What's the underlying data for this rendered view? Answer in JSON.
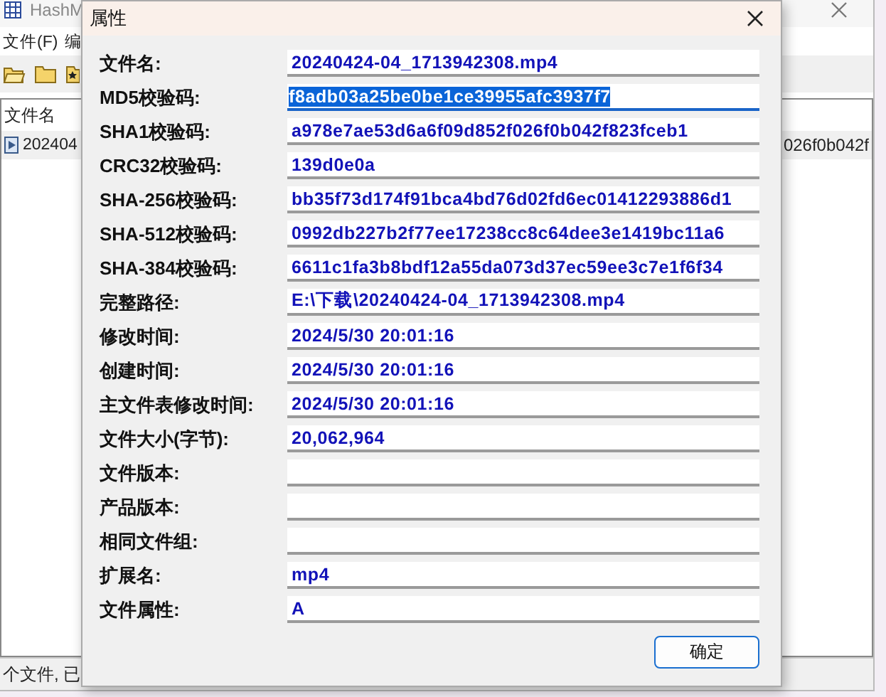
{
  "background_window": {
    "title": "HashM",
    "menu": [
      "文件(F)",
      "编"
    ],
    "list": {
      "column_1": "文件名",
      "row": {
        "name": "202404",
        "hash": "026f0b042f"
      }
    },
    "status_bar": "个文件, 已"
  },
  "dialog": {
    "title": "属性",
    "fields": [
      {
        "label": "文件名:",
        "value": "20240424-04_1713942308.mp4",
        "selected": false
      },
      {
        "label": "MD5校验码:",
        "value": "f8adb03a25be0be1ce39955afc3937f7",
        "selected": true
      },
      {
        "label": "SHA1校验码:",
        "value": "a978e7ae53d6a6f09d852f026f0b042f823fceb1",
        "selected": false
      },
      {
        "label": "CRC32校验码:",
        "value": "139d0e0a",
        "selected": false
      },
      {
        "label": "SHA-256校验码:",
        "value": "bb35f73d174f91bca4bd76d02fd6ec01412293886d1",
        "selected": false
      },
      {
        "label": "SHA-512校验码:",
        "value": "0992db227b2f77ee17238cc8c64dee3e1419bc11a6",
        "selected": false
      },
      {
        "label": "SHA-384校验码:",
        "value": "6611c1fa3b8bdf12a55da073d37ec59ee3c7e1f6f34",
        "selected": false
      },
      {
        "label": "完整路径:",
        "value": "E:\\下载\\20240424-04_1713942308.mp4",
        "selected": false
      },
      {
        "label": "修改时间:",
        "value": "2024/5/30 20:01:16",
        "selected": false
      },
      {
        "label": "创建时间:",
        "value": "2024/5/30 20:01:16",
        "selected": false
      },
      {
        "label": "主文件表修改时间:",
        "value": "2024/5/30 20:01:16",
        "selected": false
      },
      {
        "label": "文件大小(字节):",
        "value": "20,062,964",
        "selected": false
      },
      {
        "label": "文件版本:",
        "selected": false
      },
      {
        "label": "产品版本:",
        "selected": false
      },
      {
        "label": "相同文件组:",
        "selected": false
      },
      {
        "label": "扩展名:",
        "value": "mp4",
        "selected": false
      },
      {
        "label": "文件属性:",
        "value": "A",
        "selected": false
      }
    ],
    "buttons": [
      "确定"
    ]
  }
}
